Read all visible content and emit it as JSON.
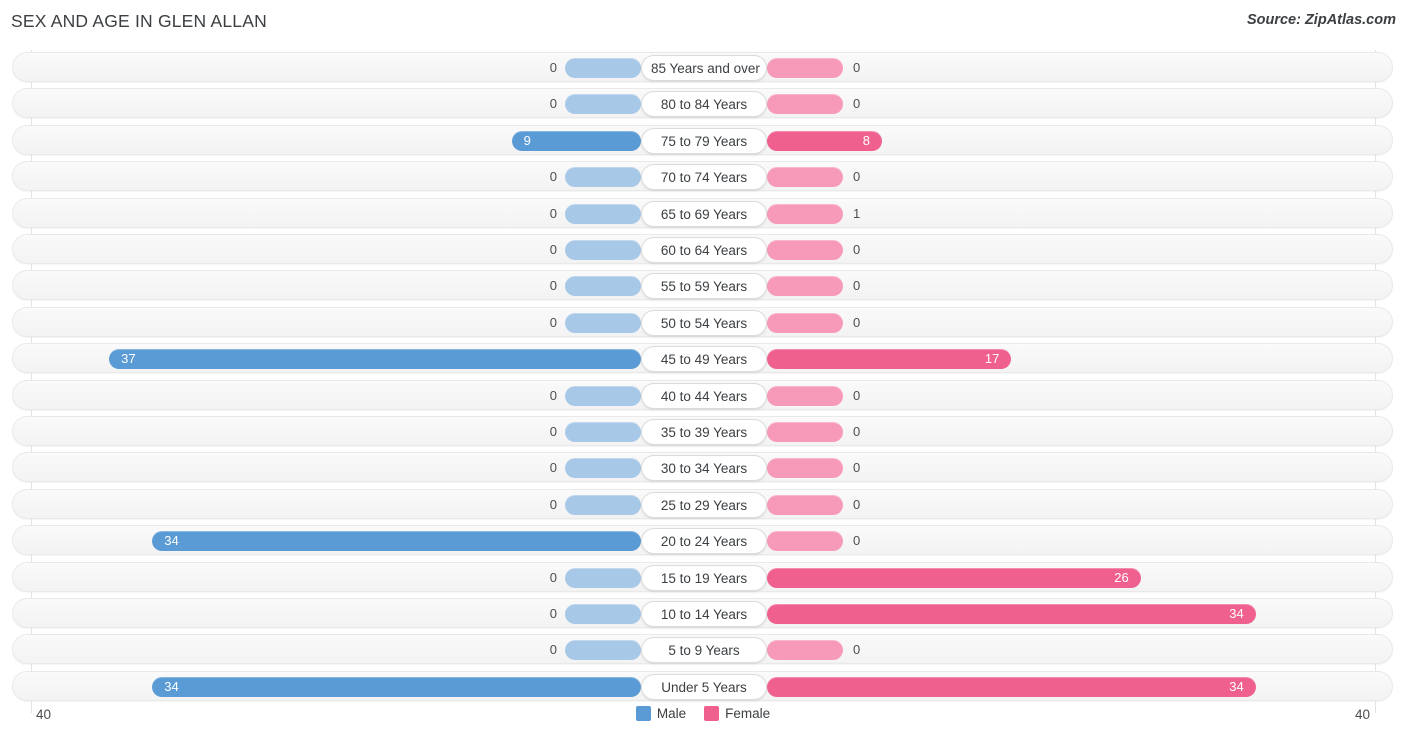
{
  "header": {
    "title": "SEX AND AGE IN GLEN ALLAN",
    "source": "Source: ZipAtlas.com"
  },
  "legend": {
    "male_label": "Male",
    "female_label": "Female",
    "male_color": "#5b9bd5",
    "female_color": "#f0608f"
  },
  "axis": {
    "left_max": "40",
    "right_max": "40"
  },
  "chart_data": {
    "type": "bar",
    "subtype": "population-pyramid",
    "title": "SEX AND AGE IN GLEN ALLAN",
    "xlabel": "",
    "ylabel": "",
    "xlim": [
      40,
      40
    ],
    "grid": true,
    "legend_position": "bottom-center",
    "categories": [
      "85 Years and over",
      "80 to 84 Years",
      "75 to 79 Years",
      "70 to 74 Years",
      "65 to 69 Years",
      "60 to 64 Years",
      "55 to 59 Years",
      "50 to 54 Years",
      "45 to 49 Years",
      "40 to 44 Years",
      "35 to 39 Years",
      "30 to 34 Years",
      "25 to 29 Years",
      "20 to 24 Years",
      "15 to 19 Years",
      "10 to 14 Years",
      "5 to 9 Years",
      "Under 5 Years"
    ],
    "series": [
      {
        "name": "Male",
        "color": "#5b9bd5",
        "values": [
          0,
          0,
          9,
          0,
          0,
          0,
          0,
          0,
          37,
          0,
          0,
          0,
          0,
          34,
          0,
          0,
          0,
          34
        ]
      },
      {
        "name": "Female",
        "color": "#f0608f",
        "values": [
          0,
          0,
          8,
          0,
          1,
          0,
          0,
          0,
          17,
          0,
          0,
          0,
          0,
          0,
          26,
          34,
          0,
          34
        ]
      }
    ],
    "rows": [
      {
        "age": "85 Years and over",
        "male": 0,
        "male_text": "0",
        "female": 0,
        "female_text": "0"
      },
      {
        "age": "80 to 84 Years",
        "male": 0,
        "male_text": "0",
        "female": 0,
        "female_text": "0"
      },
      {
        "age": "75 to 79 Years",
        "male": 9,
        "male_text": "9",
        "female": 8,
        "female_text": "8"
      },
      {
        "age": "70 to 74 Years",
        "male": 0,
        "male_text": "0",
        "female": 0,
        "female_text": "0"
      },
      {
        "age": "65 to 69 Years",
        "male": 0,
        "male_text": "0",
        "female": 1,
        "female_text": "1"
      },
      {
        "age": "60 to 64 Years",
        "male": 0,
        "male_text": "0",
        "female": 0,
        "female_text": "0"
      },
      {
        "age": "55 to 59 Years",
        "male": 0,
        "male_text": "0",
        "female": 0,
        "female_text": "0"
      },
      {
        "age": "50 to 54 Years",
        "male": 0,
        "male_text": "0",
        "female": 0,
        "female_text": "0"
      },
      {
        "age": "45 to 49 Years",
        "male": 37,
        "male_text": "37",
        "female": 17,
        "female_text": "17"
      },
      {
        "age": "40 to 44 Years",
        "male": 0,
        "male_text": "0",
        "female": 0,
        "female_text": "0"
      },
      {
        "age": "35 to 39 Years",
        "male": 0,
        "male_text": "0",
        "female": 0,
        "female_text": "0"
      },
      {
        "age": "30 to 34 Years",
        "male": 0,
        "male_text": "0",
        "female": 0,
        "female_text": "0"
      },
      {
        "age": "25 to 29 Years",
        "male": 0,
        "male_text": "0",
        "female": 0,
        "female_text": "0"
      },
      {
        "age": "20 to 24 Years",
        "male": 34,
        "male_text": "34",
        "female": 0,
        "female_text": "0"
      },
      {
        "age": "15 to 19 Years",
        "male": 0,
        "male_text": "0",
        "female": 26,
        "female_text": "26"
      },
      {
        "age": "10 to 14 Years",
        "male": 0,
        "male_text": "0",
        "female": 34,
        "female_text": "34"
      },
      {
        "age": "5 to 9 Years",
        "male": 0,
        "male_text": "0",
        "female": 0,
        "female_text": "0"
      },
      {
        "age": "Under 5 Years",
        "male": 34,
        "male_text": "34",
        "female": 34,
        "female_text": "34"
      }
    ]
  }
}
